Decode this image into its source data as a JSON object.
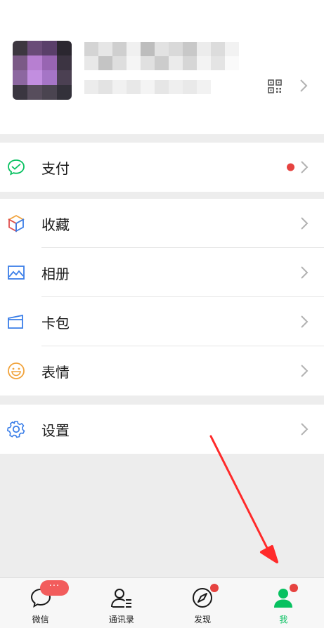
{
  "menu_groups": [
    {
      "items": [
        {
          "label": "支付",
          "icon": "pay-icon",
          "has_red_dot": true
        }
      ]
    },
    {
      "items": [
        {
          "label": "收藏",
          "icon": "favorites-cube-icon"
        },
        {
          "label": "相册",
          "icon": "album-photo-icon"
        },
        {
          "label": "卡包",
          "icon": "card-wallet-icon"
        },
        {
          "label": "表情",
          "icon": "sticker-smile-icon"
        }
      ]
    },
    {
      "items": [
        {
          "label": "设置",
          "icon": "settings-gear-icon"
        }
      ]
    }
  ],
  "tabbar": {
    "tabs": [
      {
        "label": "微信",
        "icon": "chat-bubble-icon",
        "badge": "···"
      },
      {
        "label": "通讯录",
        "icon": "contacts-icon"
      },
      {
        "label": "发现",
        "icon": "compass-icon",
        "red_dot": true
      },
      {
        "label": "我",
        "icon": "person-icon",
        "red_dot": true,
        "active": true
      }
    ]
  },
  "colors": {
    "accent_green": "#07c160",
    "badge_red": "#e64340",
    "annotation_red": "#ff2a2a"
  }
}
